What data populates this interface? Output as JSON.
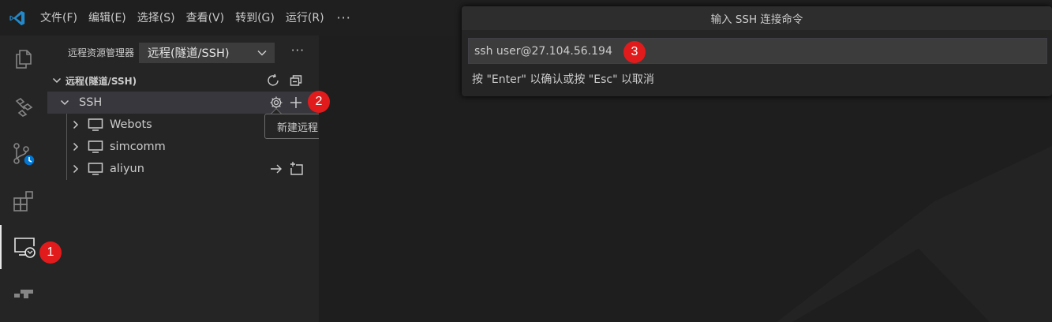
{
  "menu": {
    "items": [
      "文件(F)",
      "编辑(E)",
      "选择(S)",
      "查看(V)",
      "转到(G)",
      "运行(R)"
    ],
    "more": "···"
  },
  "activity": {
    "icons": [
      "explorer-icon",
      "source-graph-icon",
      "source-control-icon",
      "extensions-icon",
      "remote-explorer-icon",
      "timeline-icon"
    ]
  },
  "sidebar": {
    "title": "远程资源管理器",
    "select_value": "远程(隧道/SSH)",
    "more": "···",
    "section_title": "远程(隧道/SSH)",
    "group_label": "SSH",
    "hosts": [
      "Webots",
      "simcomm",
      "aliyun"
    ]
  },
  "tooltip": {
    "text": "新建远程"
  },
  "quick_input": {
    "title": "输入 SSH 连接命令",
    "value": "ssh user@27.104.56.194",
    "message": "按 \"Enter\" 以确认或按 \"Esc\" 以取消"
  },
  "badges": {
    "b1": "1",
    "b2": "2",
    "b3": "3"
  },
  "colors": {
    "accent": "#0078d4",
    "badge": "#e11b1b",
    "background": "#1e1e1e",
    "sidebar": "#252526"
  }
}
